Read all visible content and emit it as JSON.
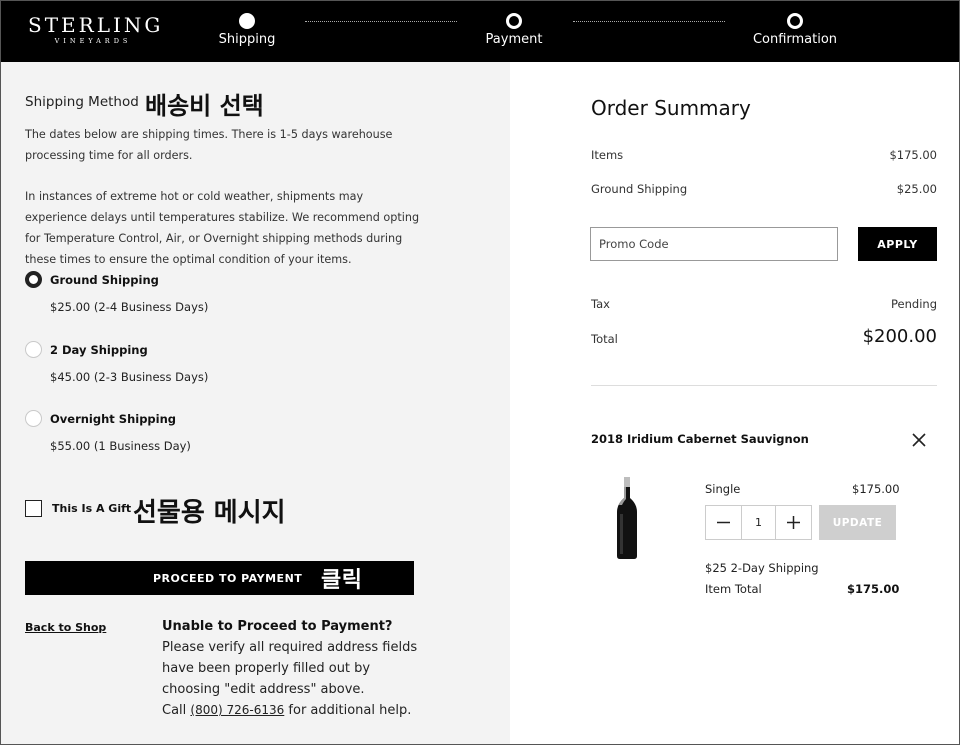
{
  "header": {
    "logo_main": "STERLING",
    "logo_sub": "VINEYARDS",
    "steps": [
      {
        "label": "Shipping",
        "state": "current"
      },
      {
        "label": "Payment",
        "state": "upcoming"
      },
      {
        "label": "Confirmation",
        "state": "upcoming"
      }
    ]
  },
  "shipping": {
    "title": "Shipping Method",
    "title_annotation": "배송비 선택",
    "para1": "The dates below are shipping times. There is 1-5 days warehouse processing time for all orders.",
    "para2": "In instances of extreme hot or cold weather, shipments may experience delays until temperatures stabilize. We recommend opting for Temperature Control, Air, or Overnight shipping methods during these times to ensure the optimal condition of your items.",
    "options": [
      {
        "name": "Ground Shipping",
        "price": "$25.00 (2-4 Business Days)",
        "selected": true
      },
      {
        "name": "2 Day Shipping",
        "price": "$45.00 (2-3 Business Days)",
        "selected": false
      },
      {
        "name": "Overnight Shipping",
        "price": "$55.00 (1 Business Day)",
        "selected": false
      }
    ],
    "gift_label": "This Is A Gift",
    "gift_annotation": "선물용 메시지",
    "gift_checked": false,
    "proceed_label": "PROCEED TO PAYMENT",
    "proceed_annotation": "클릭",
    "back_link": "Back to Shop",
    "help_title": "Unable to Proceed to Payment?",
    "help_lines": [
      "Please verify all required address fields",
      "have been properly filled out by",
      "choosing \"edit address\" above."
    ],
    "help_call_prefix": "Call",
    "help_phone": "(800) 726-6136",
    "help_call_suffix": "for additional help."
  },
  "summary": {
    "title": "Order Summary",
    "items_label": "Items",
    "items_value": "$175.00",
    "ground_label": "Ground Shipping",
    "ground_value": "$25.00",
    "promo_placeholder": "Promo Code",
    "apply_label": "APPLY",
    "tax_label": "Tax",
    "tax_value": "Pending",
    "total_label": "Total",
    "total_value": "$200.00",
    "product": {
      "name": "2018 Iridium Cabernet Sauvignon",
      "variant": "Single",
      "variant_price": "$175.00",
      "quantity": "1",
      "update_label": "UPDATE",
      "shipping_note": "$25 2-Day Shipping",
      "item_total_label": "Item Total",
      "item_total_value": "$175.00"
    }
  },
  "colors": {
    "header_bg": "#000000",
    "panel_bg": "#f3f3f3",
    "update_disabled": "#cfcfcf"
  }
}
